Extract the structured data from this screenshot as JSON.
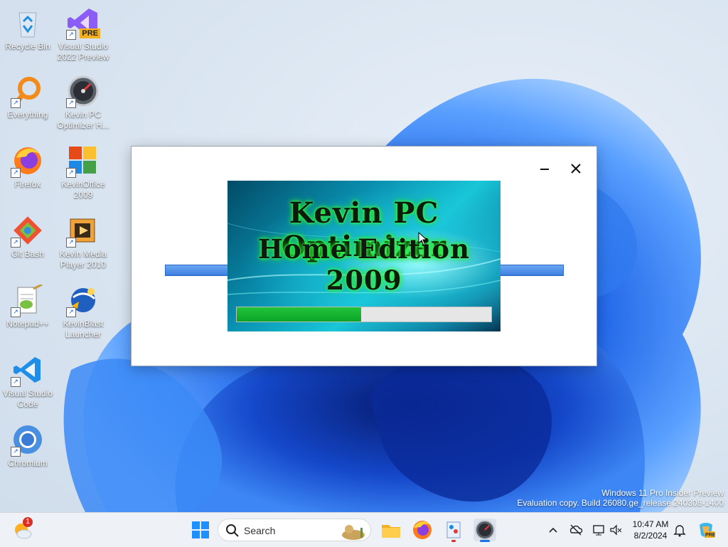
{
  "desktop": {
    "icons": [
      {
        "label": "Recycle Bin",
        "icon": "recycle-bin-icon"
      },
      {
        "label": "Visual Studio 2022 Preview",
        "icon": "visual-studio-icon",
        "badge": "PRE"
      },
      {
        "label": "Everything",
        "icon": "everything-search-icon"
      },
      {
        "label": "Kevin PC Optimizer H...",
        "icon": "optimizer-gauge-icon"
      },
      {
        "label": "Firefox",
        "icon": "firefox-icon"
      },
      {
        "label": "KevinOffice 2009",
        "icon": "office-icon"
      },
      {
        "label": "Git Bash",
        "icon": "git-bash-icon"
      },
      {
        "label": "Kevin Media Player 2010",
        "icon": "media-player-icon"
      },
      {
        "label": "Notepad++",
        "icon": "notepadpp-icon"
      },
      {
        "label": "KevinBlast Launcher",
        "icon": "launcher-icon"
      },
      {
        "label": "Visual Studio Code",
        "icon": "vscode-icon"
      },
      {
        "label": "Chromium",
        "icon": "chromium-icon"
      }
    ]
  },
  "splash": {
    "title_line1": "Kevin PC Optimizer",
    "title_line2": "Home Edition 2009",
    "progress_fraction": 0.49,
    "progress_color": "#0aa428",
    "rail_color": "#3c7fe0",
    "minimize_icon": "minimize-icon",
    "close_icon": "close-icon"
  },
  "watermark": {
    "line1": "Windows 11 Pro Insider Preview",
    "line2": "Evaluation copy. Build 26080.ge_release.240308-1400"
  },
  "taskbar": {
    "search_placeholder": "Search",
    "time": "10:47 AM",
    "date": "8/2/2024",
    "weather_badge": "1",
    "tray_icons": [
      "chevron-up-icon",
      "onedrive-icon",
      "network-icon",
      "volume-icon",
      "notification-bell-icon",
      "copilot-icon"
    ],
    "pinned": [
      "start-icon",
      "file-explorer-icon",
      "firefox-icon",
      "paint-icon",
      "optimizer-gauge-icon"
    ]
  }
}
